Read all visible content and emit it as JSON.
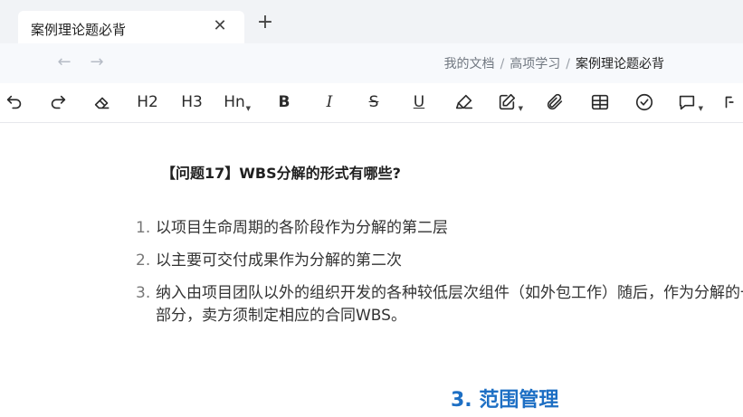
{
  "tab": {
    "title": "案例理论题必背",
    "close_label": "✕",
    "new_label": "+"
  },
  "nav": {
    "back_glyph": "←",
    "forward_glyph": "→",
    "breadcrumb": [
      "我的文档",
      "高项学习",
      "案例理论题必背"
    ],
    "separator": "/"
  },
  "toolbar": {
    "tools": [
      {
        "name": "undo",
        "icon": "undo-icon"
      },
      {
        "name": "redo",
        "icon": "redo-icon"
      },
      {
        "name": "clear-format",
        "icon": "eraser-icon"
      },
      {
        "name": "heading-2",
        "label": "H2"
      },
      {
        "name": "heading-3",
        "label": "H3"
      },
      {
        "name": "heading-n",
        "label": "Hn"
      },
      {
        "name": "bold",
        "label": "B"
      },
      {
        "name": "italic",
        "label": "I"
      },
      {
        "name": "strikethrough",
        "label": "S"
      },
      {
        "name": "underline",
        "label": "U"
      },
      {
        "name": "highlight",
        "icon": "highlighter-icon"
      },
      {
        "name": "edit",
        "icon": "pencil-square-icon"
      },
      {
        "name": "attachment",
        "icon": "paperclip-icon"
      },
      {
        "name": "table",
        "icon": "table-icon"
      },
      {
        "name": "task",
        "icon": "check-circle-icon"
      },
      {
        "name": "comment",
        "icon": "speech-bubble-icon"
      },
      {
        "name": "more",
        "icon": "more-icon"
      }
    ]
  },
  "document": {
    "question": "【问题17】WBS分解的形式有哪些?",
    "items": [
      {
        "num": "1.",
        "text": "以项目生命周期的各阶段作为分解的第二层"
      },
      {
        "num": "2.",
        "text": "以主要可交付成果作为分解的第二次"
      },
      {
        "num": "3.",
        "text": "纳入由项目团队以外的组织开发的各种较低层次组件（如外包工作）随后，作为分解的一部分，卖方须制定相应的合同WBS。"
      }
    ],
    "section_heading": "3. 范围管理"
  },
  "colors": {
    "heading_blue": "#1d6fc4",
    "tab_strip": "#f1f3f6",
    "nav_bar": "#f7f9fc"
  }
}
